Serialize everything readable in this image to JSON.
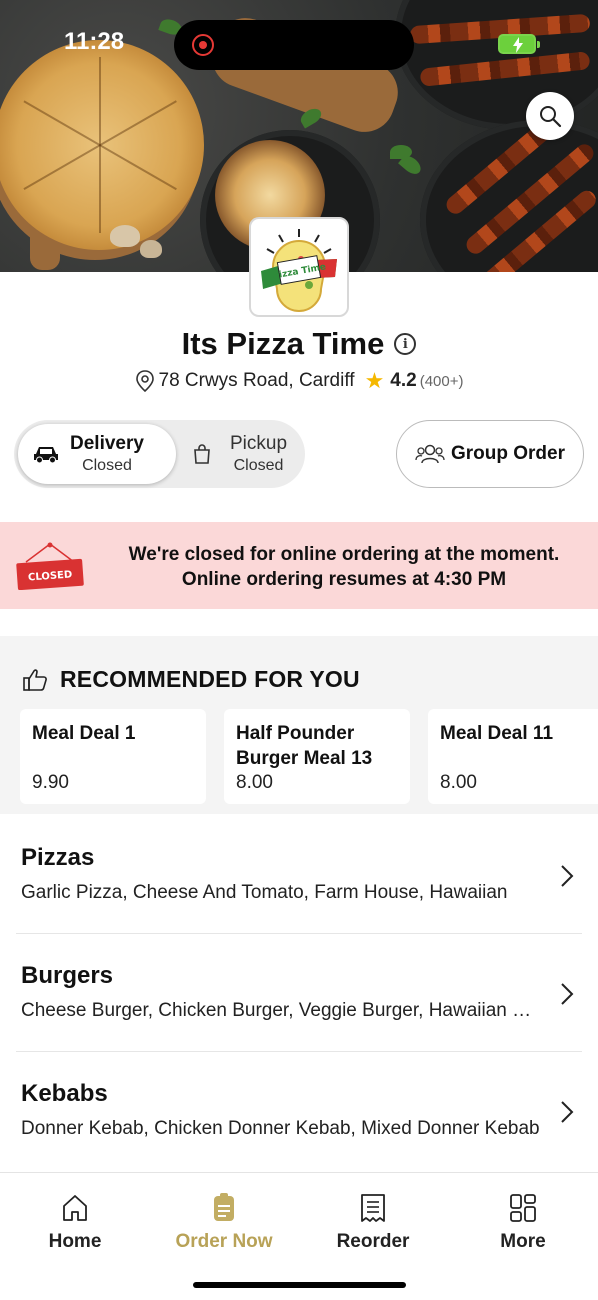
{
  "status_bar": {
    "time": "11:28"
  },
  "restaurant": {
    "name": "Its Pizza Time",
    "address": "78 Crwys Road, Cardiff",
    "rating": "4.2",
    "rating_count": "(400+)",
    "logo_text": "Pizza Time"
  },
  "order_mode": {
    "delivery": {
      "label": "Delivery",
      "status": "Closed"
    },
    "pickup": {
      "label": "Pickup",
      "status": "Closed"
    },
    "group_order_label": "Group Order"
  },
  "closed_banner": {
    "sign_text": "CLOSED",
    "line1": "We're closed for online ordering at the moment.",
    "line2": "Online ordering resumes at 4:30 PM"
  },
  "recommended": {
    "title": "RECOMMENDED FOR YOU",
    "items": [
      {
        "name": "Meal Deal 1",
        "price": "9.90"
      },
      {
        "name": "Half Pounder Burger Meal 13",
        "price": "8.00"
      },
      {
        "name": "Meal Deal 11",
        "price": "8.00"
      }
    ]
  },
  "categories": [
    {
      "name": "Pizzas",
      "items": "Garlic Pizza, Cheese And Tomato, Farm House, Hawaiian"
    },
    {
      "name": "Burgers",
      "items": "Cheese Burger, Chicken Burger, Veggie Burger, Hawaiian Burger"
    },
    {
      "name": "Kebabs",
      "items": "Donner Kebab, Chicken Donner Kebab, Mixed Donner Kebab"
    }
  ],
  "tab_bar": {
    "home": "Home",
    "order_now": "Order Now",
    "reorder": "Reorder",
    "more": "More"
  },
  "colors": {
    "accent": "#b8a257",
    "banner_bg": "#fbd8d8",
    "star": "#f5b800",
    "closed_red": "#d93232"
  }
}
